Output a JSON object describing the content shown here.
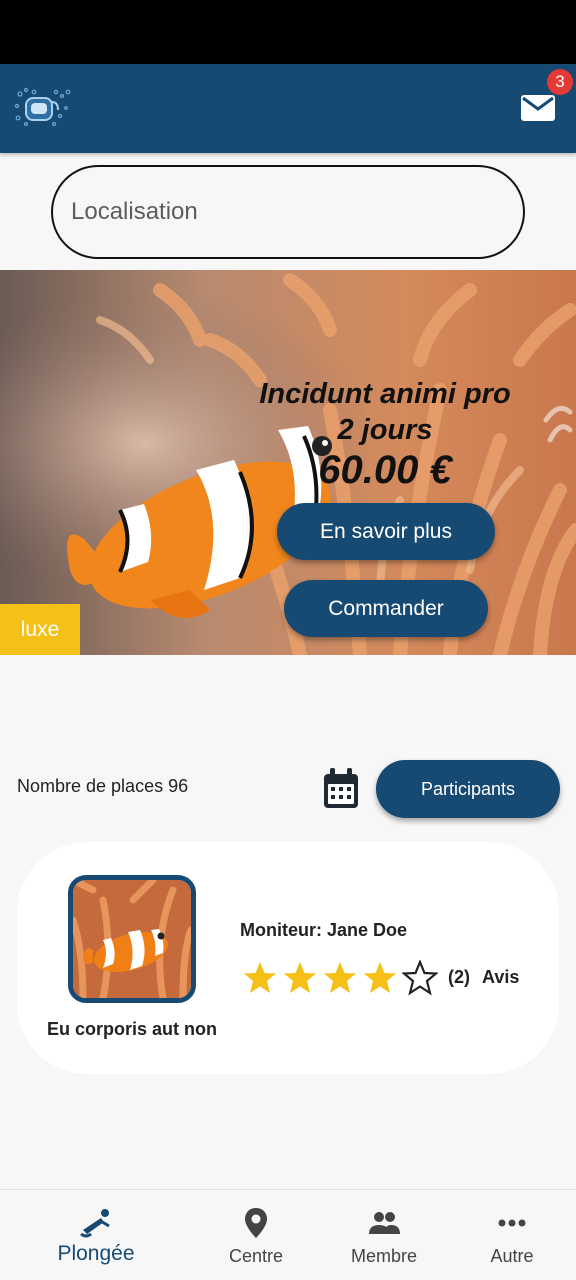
{
  "header": {
    "logo": "dive-mask-logo",
    "mail_icon": "mail-icon",
    "unread_count": "3"
  },
  "search": {
    "placeholder": "Localisation"
  },
  "hero": {
    "title": "Incidunt animi pro",
    "duration": "2 jours",
    "price": "60.00 €",
    "more_label": "En savoir plus",
    "order_label": "Commander",
    "tag": "luxe"
  },
  "places": {
    "label": "Nombre de places 96",
    "participants_label": "Participants",
    "calendar_icon": "calendar-icon"
  },
  "course": {
    "name": "Eu corporis aut non",
    "instructor": "Moniteur: Jane Doe",
    "rating": 4,
    "rating_max": 5,
    "review_count": "(2)",
    "review_label": "Avis"
  },
  "bottom_nav": [
    {
      "label": "Plongée",
      "icon": "diver-icon",
      "active": true
    },
    {
      "label": "Centre",
      "icon": "location-pin-icon",
      "active": false
    },
    {
      "label": "Membre",
      "icon": "people-icon",
      "active": false
    },
    {
      "label": "Autre",
      "icon": "more-dots-icon",
      "active": false
    }
  ],
  "colors": {
    "primary": "#174a72",
    "accent": "#f5c018",
    "badge": "#e53935",
    "star": "#f5c018"
  }
}
